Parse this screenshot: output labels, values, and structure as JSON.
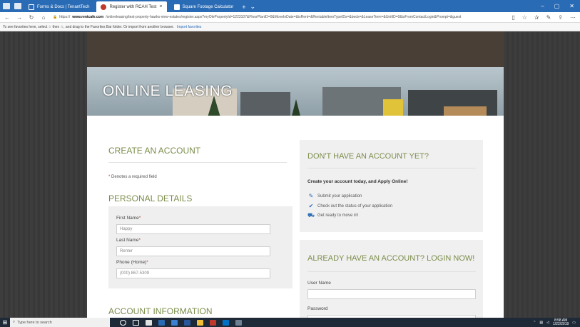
{
  "browser": {
    "tabs": [
      {
        "label": "Forms & Docs | TenantTech",
        "active": false
      },
      {
        "label": "Register with RCAH Test",
        "active": true
      },
      {
        "label": "Square Footage Calculator",
        "active": false
      }
    ],
    "new_tab": "+",
    "url_prefix": "https://",
    "url_domain": "www.rentcafe.com",
    "url_path": "/onlineleasing/test-property-hawks-view-estates/register.aspx?myOlePropertyId=1223107&FloorPlanID=0&MoveInDate=&isRent=&RentableItemTypeIDs=&beds=&LeaseTerm=&UnitID=0&isFromContactLogin&Prompt=&guest",
    "favorites_text": "To see favorites here, select ☆ then ☆, and drag to the Favorites Bar folder. Or import from another browser.",
    "favorites_link": "Import favorites"
  },
  "banner": {
    "title": "ONLINE LEASING"
  },
  "create": {
    "heading": "CREATE AN ACCOUNT",
    "required_star": "*",
    "required_note": " Denotes a required field"
  },
  "personal": {
    "heading": "PERSONAL DETAILS",
    "first_name_label": "First Name",
    "first_name_value": "Happy",
    "last_name_label": "Last Name",
    "last_name_value": "Renter",
    "phone_label": "Phone (Home)",
    "phone_value": "(000) 867-5309",
    "star": "*"
  },
  "account": {
    "heading": "ACCOUNT INFORMATION"
  },
  "promo": {
    "heading": "DON'T HAVE AN ACCOUNT YET?",
    "intro": "Create your account today, and Apply Online!",
    "items": [
      "Submit your application",
      "Check out the status of your application",
      "Get ready to move in!"
    ]
  },
  "login": {
    "heading": "ALREADY HAVE AN ACCOUNT? LOGIN NOW!",
    "username_label": "User Name",
    "password_label": "Password"
  },
  "taskbar": {
    "search_placeholder": "Type here to search",
    "time": "8:58 AM",
    "date": "1/22/2019"
  },
  "colors": {
    "accent": "#7b8d4a",
    "browser": "#2a6bb5",
    "required": "#c0392b"
  }
}
